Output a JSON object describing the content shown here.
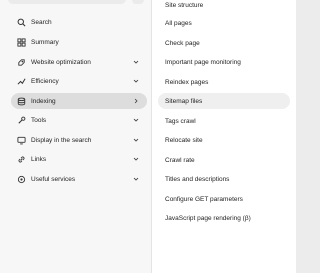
{
  "sidebar": {
    "items": [
      {
        "label": "Search",
        "icon": "search-icon",
        "has_chevron": false
      },
      {
        "label": "Summary",
        "icon": "grid-icon",
        "has_chevron": false
      },
      {
        "label": "Website optimization",
        "icon": "rocket-icon",
        "has_chevron": true,
        "chevron": "chevron-down-icon"
      },
      {
        "label": "Efficiency",
        "icon": "chart-icon",
        "has_chevron": true,
        "chevron": "chevron-down-icon"
      },
      {
        "label": "Indexing",
        "icon": "database-icon",
        "has_chevron": true,
        "chevron": "chevron-right-icon",
        "active": true
      },
      {
        "label": "Tools",
        "icon": "tools-icon",
        "has_chevron": true,
        "chevron": "chevron-down-icon"
      },
      {
        "label": "Display in the search",
        "icon": "display-icon",
        "has_chevron": true,
        "chevron": "chevron-down-icon"
      },
      {
        "label": "Links",
        "icon": "link-icon",
        "has_chevron": true,
        "chevron": "chevron-down-icon"
      },
      {
        "label": "Useful services",
        "icon": "services-icon",
        "has_chevron": true,
        "chevron": "chevron-down-icon"
      }
    ]
  },
  "submenu": {
    "items": [
      {
        "label": "Site structure"
      },
      {
        "label": "All pages"
      },
      {
        "label": "Check page"
      },
      {
        "label": "Important page monitoring"
      },
      {
        "label": "Reindex pages"
      },
      {
        "label": "Sitemap files",
        "active": true
      },
      {
        "label": "Tags crawl"
      },
      {
        "label": "Relocate site"
      },
      {
        "label": "Crawl rate"
      },
      {
        "label": "Titles and descriptions"
      },
      {
        "label": "Configure GET parameters"
      },
      {
        "label": "JavaScript page rendering (β)"
      }
    ]
  },
  "colors": {
    "active_bg": "#dddddd",
    "submenu_active_bg": "#efefef",
    "text": "#1f1f1f"
  }
}
